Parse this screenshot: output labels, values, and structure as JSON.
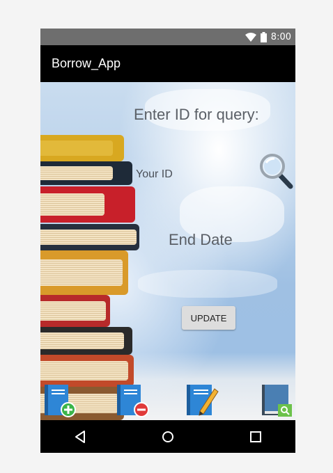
{
  "status_bar": {
    "time": "8:00",
    "icons": [
      "wifi-icon",
      "battery-icon"
    ]
  },
  "app_bar": {
    "title": "Borrow_App"
  },
  "form": {
    "query_label": "Enter ID for query:",
    "id_field_hint": "Your ID",
    "end_date_label": "End Date",
    "update_button": "UPDATE"
  },
  "toolbar": {
    "icons": [
      "add-book-icon",
      "remove-book-icon",
      "edit-book-icon",
      "search-book-icon"
    ]
  },
  "nav_bar": {
    "icons": [
      "back-icon",
      "home-icon",
      "recents-icon"
    ]
  },
  "colors": {
    "app_bar": "#000000",
    "status_bar": "#6e6e6e",
    "add_badge": "#3bb54a",
    "remove_badge": "#e03a3a",
    "search_badge": "#6cc24a",
    "book_blue": "#2e86d6"
  }
}
